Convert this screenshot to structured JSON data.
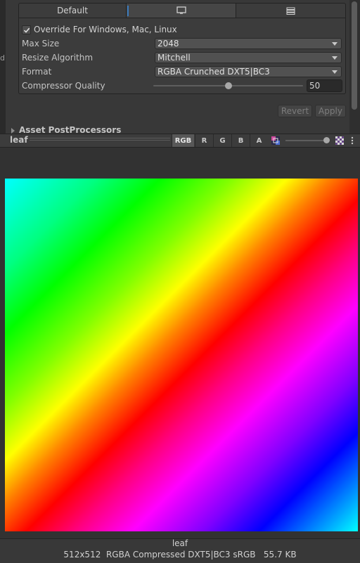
{
  "platform_tabs": {
    "default_label": "Default",
    "standalone_icon": "monitor-icon",
    "server_icon": "server-icon",
    "active": "standalone"
  },
  "left_edge_glyph": "d",
  "override": {
    "checked": true,
    "label": "Override For Windows, Mac, Linux"
  },
  "fields": {
    "max_size": {
      "label": "Max Size",
      "value": "2048"
    },
    "resize_algorithm": {
      "label": "Resize Algorithm",
      "value": "Mitchell"
    },
    "format": {
      "label": "Format",
      "value": "RGBA Crunched DXT5|BC3"
    },
    "compressor_quality": {
      "label": "Compressor Quality",
      "value": "50",
      "fraction": 0.5
    }
  },
  "buttons": {
    "revert": "Revert",
    "apply": "Apply"
  },
  "postprocessors": {
    "label": "Asset PostProcessors"
  },
  "preview_toolbar": {
    "title": "leaf",
    "channels": {
      "rgb": "RGB",
      "r": "R",
      "g": "G",
      "b": "B",
      "a": "A"
    },
    "active_channel": "RGB",
    "mip_level_fraction": 1.0
  },
  "footer": {
    "name": "leaf",
    "info": "512x512  RGBA Compressed DXT5|BC3 sRGB   55.7 KB"
  },
  "colors": {
    "background": "#383838",
    "accent": "#3a79bb"
  }
}
